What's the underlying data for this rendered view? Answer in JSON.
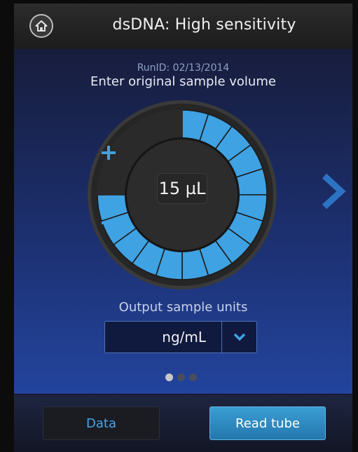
{
  "header": {
    "title": "dsDNA: High sensitivity",
    "home_icon": "home-icon"
  },
  "main": {
    "run_id": "RunID: 02/13/2014",
    "instruction": "Enter original sample volume",
    "volume": {
      "value_text": "15 µL",
      "value": 15,
      "unit": "µL",
      "dial_segments_total": 20,
      "dial_segments_filled": 15,
      "increment_symbol": "+",
      "decrement_symbol": "−"
    },
    "next_icon": "chevron-right-icon",
    "output_units": {
      "label": "Output sample units",
      "selected": "ng/mL",
      "dropdown_icon": "chevron-down-icon"
    },
    "pager": {
      "total": 3,
      "active_index": 0
    }
  },
  "footer": {
    "data_button": "Data",
    "read_button": "Read tube"
  },
  "colors": {
    "accent_blue": "#3fa2e3",
    "dial_empty": "#2a2a2a",
    "background_top": "#171d3c",
    "background_bottom": "#23449d",
    "read_button": "#2e8ccb",
    "data_button_text": "#4aa4e8"
  }
}
